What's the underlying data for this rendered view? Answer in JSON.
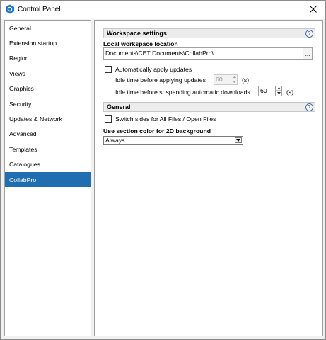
{
  "window": {
    "title": "Control Panel"
  },
  "sidebar": {
    "items": [
      {
        "label": "General"
      },
      {
        "label": "Extension startup"
      },
      {
        "label": "Region"
      },
      {
        "label": "Views"
      },
      {
        "label": "Graphics"
      },
      {
        "label": "Security"
      },
      {
        "label": "Updates & Network"
      },
      {
        "label": "Advanced"
      },
      {
        "label": "Templates"
      },
      {
        "label": "Catalogues"
      },
      {
        "label": "CollabPro",
        "selected": true
      }
    ]
  },
  "workspace": {
    "section_title": "Workspace settings",
    "help": "?",
    "location_label": "Local workspace location",
    "location_value": "Documents\\CET Documents\\CollabPro\\",
    "browse_label": "...",
    "auto_update_label": "Automatically apply updates",
    "auto_update_checked": false,
    "idle_apply_label": "Idle time before applying updates",
    "idle_apply_value": "60",
    "idle_apply_unit": "(s)",
    "idle_suspend_label": "Idle time before suspending automatic downloads",
    "idle_suspend_value": "60",
    "idle_suspend_unit": "(s)"
  },
  "general": {
    "section_title": "General",
    "help": "?",
    "switch_sides_label": "Switch sides for All Files / Open Files",
    "switch_sides_checked": false,
    "bg_color_label": "Use section color for 2D background",
    "bg_color_value": "Always"
  },
  "colors": {
    "accent": "#1f6fb0",
    "section_header_bg": "#ececec"
  },
  "icons": {
    "app": "cet-hexagon-icon",
    "close": "close-icon",
    "help": "help-icon"
  }
}
